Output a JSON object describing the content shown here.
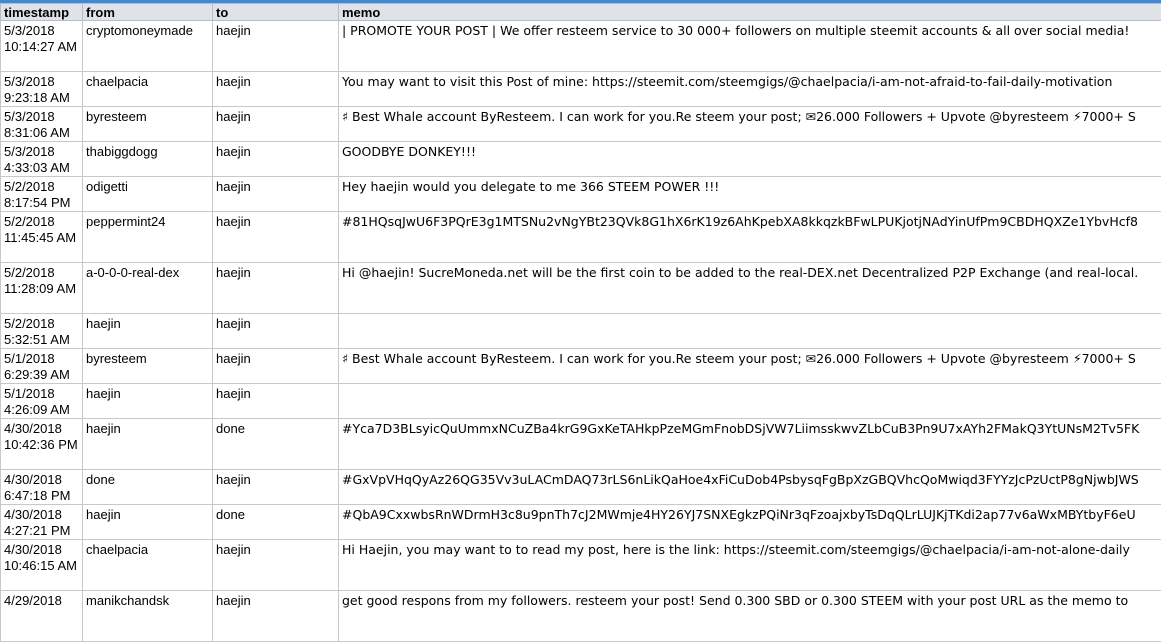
{
  "columns": [
    "timestamp",
    "from",
    "to",
    "memo"
  ],
  "rows": [
    {
      "timestamp": "5/3/2018 10:14:27 AM",
      "from": "cryptomoneymade",
      "to": "haejin",
      "memo": "| PROMOTE YOUR POST | We offer resteem service to 30 000+ followers on multiple steemit accounts & all over social media!"
    },
    {
      "timestamp": "5/3/2018 9:23:18 AM",
      "from": "chaelpacia",
      "to": "haejin",
      "memo": "You may want to visit this Post of mine: https://steemit.com/steemgigs/@chaelpacia/i-am-not-afraid-to-fail-daily-motivation"
    },
    {
      "timestamp": "5/3/2018 8:31:06 AM",
      "from": "byresteem",
      "to": "haejin",
      "memo": "♯ Best Whale account ByResteem. I can work for you.Re steem your post; ✉26.000 Followers + Upvote @byresteem ⚡7000+ S"
    },
    {
      "timestamp": "5/3/2018 4:33:03 AM",
      "from": "thabiggdogg",
      "to": "haejin",
      "memo": "GOODBYE DONKEY!!!"
    },
    {
      "timestamp": "5/2/2018 8:17:54 PM",
      "from": "odigetti",
      "to": "haejin",
      "memo": "Hey haejin would you delegate to me 366 STEEM POWER !!!"
    },
    {
      "timestamp": "5/2/2018 11:45:45 AM",
      "from": "peppermint24",
      "to": "haejin",
      "memo": "#81HQsqJwU6F3PQrE3g1MTSNu2vNgYBt23QVk8G1hX6rK19z6AhKpebXA8kkqzkBFwLPUKjotjNAdYinUfPm9CBDHQXZe1YbvHcf8"
    },
    {
      "timestamp": "5/2/2018 11:28:09 AM",
      "from": "a-0-0-0-real-dex",
      "to": "haejin",
      "memo": "Hi @haejin! SucreMoneda.net will be the first coin to be added to the real-DEX.net Decentralized P2P Exchange (and real-local."
    },
    {
      "timestamp": "5/2/2018 5:32:51 AM",
      "from": "haejin",
      "to": "haejin",
      "memo": ""
    },
    {
      "timestamp": "5/1/2018 6:29:39 AM",
      "from": "byresteem",
      "to": "haejin",
      "memo": "♯ Best Whale account ByResteem. I can work for you.Re steem your post; ✉26.000 Followers + Upvote @byresteem ⚡7000+ S"
    },
    {
      "timestamp": "5/1/2018 4:26:09 AM",
      "from": "haejin",
      "to": "haejin",
      "memo": ""
    },
    {
      "timestamp": "4/30/2018 10:42:36 PM",
      "from": "haejin",
      "to": "done",
      "memo": "#Yca7D3BLsyicQuUmmxNCuZBa4krG9GxKeTAHkpPzeMGmFnobDSjVW7LiimsskwvZLbCuB3Pn9U7xAYh2FMakQ3YtUNsM2Tv5FK"
    },
    {
      "timestamp": "4/30/2018 6:47:18 PM",
      "from": "done",
      "to": "haejin",
      "memo": "#GxVpVHqQyAz26QG35Vv3uLACmDAQ73rLS6nLikQaHoe4xFiCuDob4PsbysqFgBpXzGBQVhcQoMwiqd3FYYzJcPzUctP8gNjwbJWS"
    },
    {
      "timestamp": "4/30/2018 4:27:21 PM",
      "from": "haejin",
      "to": "done",
      "memo": "#QbA9CxxwbsRnWDrmH3c8u9pnTh7cJ2MWmje4HY26YJ7SNXEgkzPQiNr3qFzoajxbyTsDqQLrLUJKjTKdi2ap77v6aWxMBYtbyF6eU"
    },
    {
      "timestamp": "4/30/2018 10:46:15 AM",
      "from": "chaelpacia",
      "to": "haejin",
      "memo": "Hi Haejin, you may want to to read my post, here is the link: https://steemit.com/steemgigs/@chaelpacia/i-am-not-alone-daily"
    },
    {
      "timestamp": "4/29/2018",
      "from": "manikchandsk",
      "to": "haejin",
      "memo": "get good respons from my followers. resteem  your post! Send 0.300 SBD or 0.300 STEEM with your post URL as the memo to"
    }
  ]
}
